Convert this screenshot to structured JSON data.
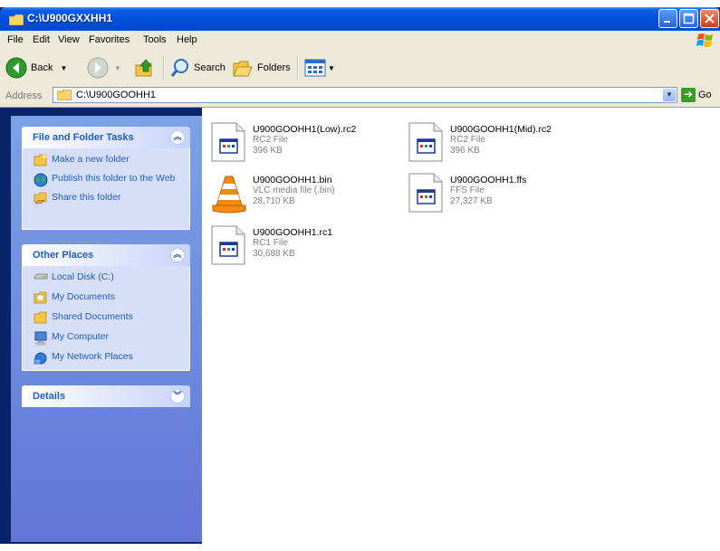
{
  "window": {
    "title": "C:\\U900GXXHH1"
  },
  "menu": [
    "File",
    "Edit",
    "View",
    "Favorites",
    "Tools",
    "Help"
  ],
  "toolbar": {
    "back_label": "Back",
    "search_label": "Search",
    "folders_label": "Folders"
  },
  "address": {
    "label": "Address",
    "value": "C:\\U900GOOHH1",
    "go_label": "Go"
  },
  "file_tasks": {
    "title": "File and Folder Tasks",
    "items": [
      {
        "label": "Make a new folder",
        "icon": "new-folder-icon"
      },
      {
        "label": "Publish this folder to the Web",
        "icon": "globe-icon"
      },
      {
        "label": "Share this folder",
        "icon": "share-folder-icon"
      }
    ]
  },
  "other_places": {
    "title": "Other Places",
    "items": [
      {
        "label": "Local Disk (C:)",
        "icon": "drive-icon"
      },
      {
        "label": "My Documents",
        "icon": "my-documents-icon"
      },
      {
        "label": "Shared Documents",
        "icon": "folder-icon"
      },
      {
        "label": "My Computer",
        "icon": "computer-icon"
      },
      {
        "label": "My Network Places",
        "icon": "network-icon"
      }
    ]
  },
  "details": {
    "title": "Details"
  },
  "files": [
    {
      "name": "U900GOOHH1(Low).rc2",
      "type": "RC2 File",
      "size": "396 KB",
      "icon": "generic-file-icon"
    },
    {
      "name": "U900GOOHH1(Mid).rc2",
      "type": "RC2 File",
      "size": "396 KB",
      "icon": "generic-file-icon"
    },
    {
      "name": "U900GOOHH1.bin",
      "type": "VLC media file (.bin)",
      "size": "28,710 KB",
      "icon": "vlc-cone-icon"
    },
    {
      "name": "U900GOOHH1.ffs",
      "type": "FFS File",
      "size": "27,327 KB",
      "icon": "generic-file-icon"
    },
    {
      "name": "U900GOOHH1.rc1",
      "type": "RC1 File",
      "size": "30,688 KB",
      "icon": "generic-file-icon"
    }
  ]
}
